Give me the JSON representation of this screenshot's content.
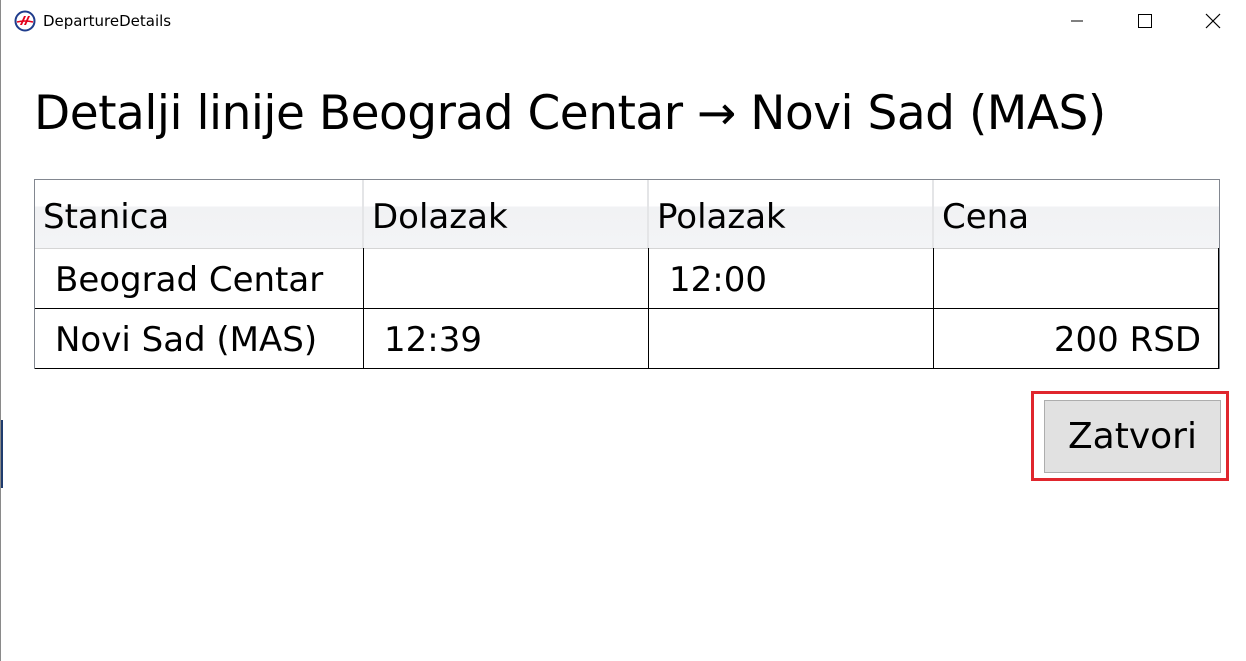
{
  "window": {
    "title": "DepartureDetails",
    "icon": "app-logo-icon",
    "controls": {
      "minimize": "minimize-icon",
      "maximize": "maximize-icon",
      "close": "close-icon"
    }
  },
  "heading": "Detalji linije Beograd Centar → Novi Sad (MAS)",
  "table": {
    "columns": [
      "Stanica",
      "Dolazak",
      "Polazak",
      "Cena"
    ],
    "rows": [
      {
        "stanica": "Beograd Centar",
        "dolazak": "",
        "polazak": "12:00",
        "cena": ""
      },
      {
        "stanica": "Novi Sad (MAS)",
        "dolazak": "12:39",
        "polazak": "",
        "cena": "200 RSD"
      }
    ]
  },
  "actions": {
    "close_label": "Zatvori"
  },
  "colors": {
    "highlight": "#e0262d",
    "button_bg": "#e1e1e1",
    "logo_red": "#e3001b",
    "logo_blue": "#1f3c8c"
  }
}
